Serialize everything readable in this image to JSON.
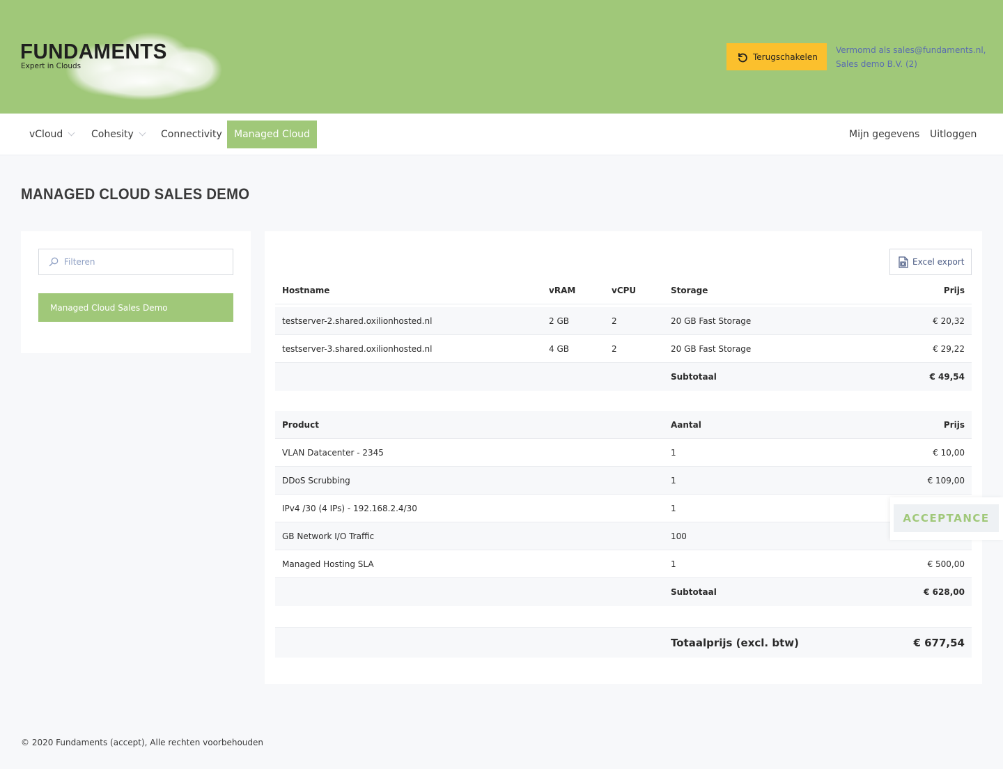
{
  "header": {
    "logo_word": "FUNDAMENTS",
    "logo_tagline": "Expert in Clouds",
    "switch_button": "Terugschakelen",
    "impersonation_line1": "Vermomd als sales@fundaments.nl,",
    "impersonation_line2": "Sales demo B.V. (2)"
  },
  "nav": {
    "items": [
      {
        "label": "vCloud",
        "has_dropdown": true
      },
      {
        "label": "Cohesity",
        "has_dropdown": true
      },
      {
        "label": "Connectivity",
        "has_dropdown": false
      },
      {
        "label": "Managed Cloud",
        "active": true
      }
    ],
    "right": [
      "Mijn gegevens",
      "Uitloggen"
    ]
  },
  "page_title": "MANAGED CLOUD SALES DEMO",
  "sidebar": {
    "filter_placeholder": "Filteren",
    "selected_item": "Managed Cloud Sales Demo"
  },
  "main": {
    "excel_button": "Excel export",
    "servers": {
      "headers": {
        "hostname": "Hostname",
        "vram": "vRAM",
        "vcpu": "vCPU",
        "storage": "Storage",
        "price": "Prijs"
      },
      "rows": [
        {
          "hostname": "testserver-2.shared.oxilionhosted.nl",
          "vram": "2 GB",
          "vcpu": "2",
          "storage": "20 GB Fast Storage",
          "price": "€ 20,32"
        },
        {
          "hostname": "testserver-3.shared.oxilionhosted.nl",
          "vram": "4 GB",
          "vcpu": "2",
          "storage": "20 GB Fast Storage",
          "price": "€ 29,22"
        }
      ],
      "subtotal_label": "Subtotaal",
      "subtotal_value": "€ 49,54"
    },
    "products": {
      "headers": {
        "product": "Product",
        "quantity": "Aantal",
        "price": "Prijs"
      },
      "rows": [
        {
          "product": "VLAN Datacenter - 2345",
          "quantity": "1",
          "price": "€ 10,00"
        },
        {
          "product": "DDoS Scrubbing",
          "quantity": "1",
          "price": "€ 109,00"
        },
        {
          "product": "IPv4 /30 (4 IPs) - 192.168.2.4/30",
          "quantity": "1",
          "price": ""
        },
        {
          "product": "GB Network I/O Traffic",
          "quantity": "100",
          "price": ""
        },
        {
          "product": "Managed Hosting SLA",
          "quantity": "1",
          "price": "€ 500,00"
        }
      ],
      "subtotal_label": "Subtotaal",
      "subtotal_value": "€ 628,00"
    },
    "total_label": "Totaalprijs (excl. btw)",
    "total_value": "€ 677,54"
  },
  "environment_badge": "ACCEPTANCE",
  "footer": "© 2020 Fundaments (accept), Alle rechten voorbehouden",
  "colors": {
    "brand_green": "#a0c879",
    "switch_yellow": "#fbc02d",
    "link_blue": "#5a6db0",
    "page_bg": "#f7f8fa"
  }
}
